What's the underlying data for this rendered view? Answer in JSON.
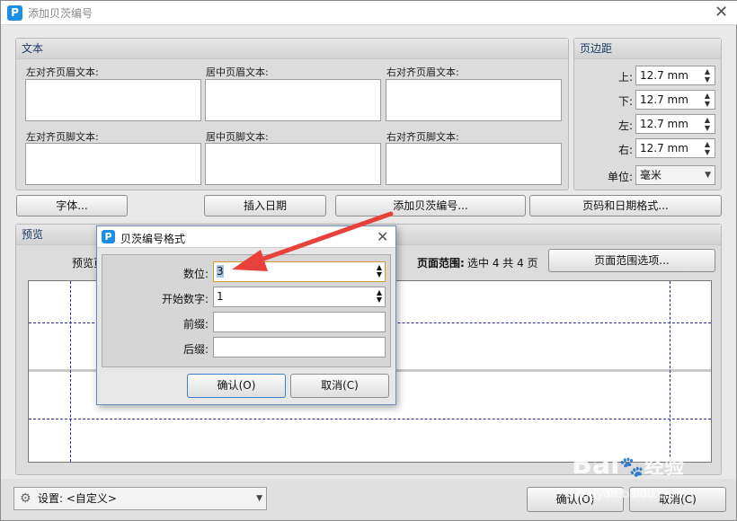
{
  "window": {
    "title": "添加贝茨编号",
    "close_glyph": "✕",
    "logo_letter": "P"
  },
  "text_group": {
    "header": "文本",
    "left_header_label": "左对齐页眉文本:",
    "center_header_label": "居中页眉文本:",
    "right_header_label": "右对齐页眉文本:",
    "left_footer_label": "左对齐页脚文本:",
    "center_footer_label": "居中页脚文本:",
    "right_footer_label": "右对齐页脚文本:"
  },
  "margins": {
    "header": "页边距",
    "top_label": "上:",
    "top_value": "12.7 mm",
    "bottom_label": "下:",
    "bottom_value": "12.7 mm",
    "left_label": "左:",
    "left_value": "12.7 mm",
    "right_label": "右:",
    "right_value": "12.7 mm",
    "unit_label": "单位:",
    "unit_value": "毫米"
  },
  "toolbar": {
    "font_button": "字体...",
    "insert_date_button": "插入日期",
    "add_bates_button": "添加贝茨编号...",
    "page_date_format_button": "页码和日期格式..."
  },
  "preview": {
    "header": "预览",
    "preview_page_label": "预览页",
    "page_range_label": "页面范围:",
    "page_range_value": "选中 4 共 4 页",
    "page_range_options_button": "页面范围选项..."
  },
  "bottom": {
    "settings_label": "设置:",
    "settings_value": "<自定义>",
    "ok_button": "确认(O)",
    "cancel_button": "取消(C)"
  },
  "dialog": {
    "title": "贝茨编号格式",
    "close_glyph": "✕",
    "digits_label": "数位:",
    "digits_value": "3",
    "start_label": "开始数字:",
    "start_value": "1",
    "prefix_label": "前缀:",
    "prefix_value": "",
    "suffix_label": "后缀:",
    "suffix_value": "",
    "ok_button": "确认(O)",
    "cancel_button": "取消(C)"
  },
  "watermark": {
    "brand": "Bai",
    "brand2": "经验",
    "url": "jingyan.baidu.com"
  },
  "colors": {
    "accent": "#1b8fe6",
    "arrow": "#e8413c",
    "guide": "#2a2aa0"
  }
}
